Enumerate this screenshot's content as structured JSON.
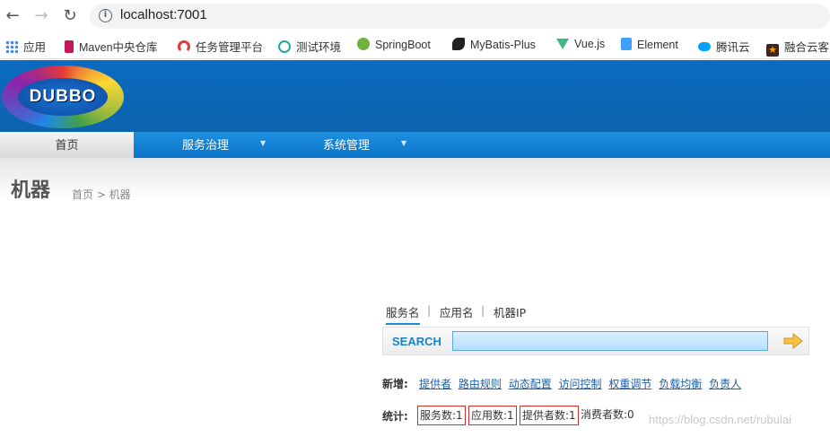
{
  "browser": {
    "url": "localhost:7001",
    "bookmarks": [
      {
        "label": "应用",
        "icon": "apps-grid-icon",
        "color": "#4285f4"
      },
      {
        "label": "Maven中央仓库",
        "icon": "maven-icon",
        "color": "#c2185b"
      },
      {
        "label": "任务管理平台",
        "icon": "arc-icon",
        "color": "#e53935"
      },
      {
        "label": "测试环境",
        "icon": "r-circle-icon",
        "color": "#26a69a"
      },
      {
        "label": "SpringBoot",
        "icon": "spring-leaf-icon",
        "color": "#6db33f"
      },
      {
        "label": "MyBatis-Plus",
        "icon": "bird-icon",
        "color": "#222222"
      },
      {
        "label": "Vue.js",
        "icon": "vue-icon",
        "color": "#41b883"
      },
      {
        "label": "Element",
        "icon": "element-icon",
        "color": "#409eff"
      },
      {
        "label": "腾讯云",
        "icon": "cloud-icon",
        "color": "#00a4ff"
      },
      {
        "label": "融合云客",
        "icon": "star-icon",
        "color": "#e65100"
      }
    ]
  },
  "header": {
    "logo_text": "DUBBO"
  },
  "menu": {
    "items": [
      {
        "label": "首页"
      },
      {
        "label": "服务治理"
      },
      {
        "label": "系统管理"
      }
    ]
  },
  "page": {
    "title": "机器",
    "breadcrumb": "首页 > 机器"
  },
  "search": {
    "tabs": [
      "服务名",
      "应用名",
      "机器IP"
    ],
    "label": "SEARCH",
    "value": ""
  },
  "add": {
    "label": "新增:",
    "links": [
      "提供者",
      "路由规则",
      "动态配置",
      "访问控制",
      "权重调节",
      "负载均衡",
      "负责人"
    ]
  },
  "stats": {
    "label": "统计:",
    "items": [
      "服务数:1",
      "应用数:1",
      "提供者数:1",
      "消费者数:0"
    ]
  },
  "watermark": "https://blog.csdn.net/rubulai",
  "colors": {
    "header_blue": "#0a6cc0",
    "menu_blue": "#1d8fe0",
    "highlight_red": "#d32f2f",
    "link_blue": "#1a5fa8"
  }
}
